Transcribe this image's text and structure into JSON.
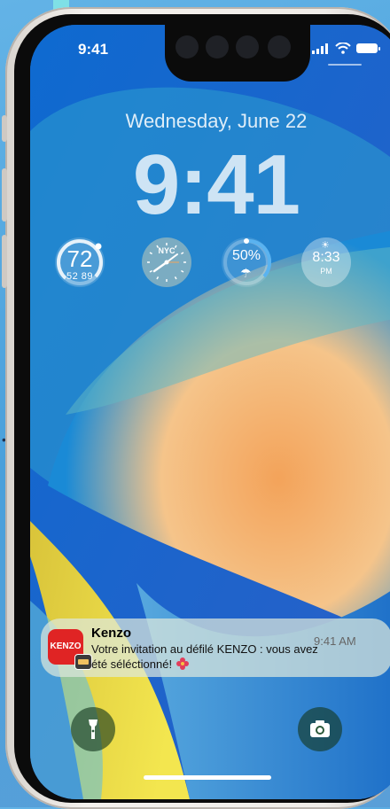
{
  "status_bar": {
    "time": "9:41"
  },
  "lock_screen": {
    "date": "Wednesday, June 22",
    "time": "9:41"
  },
  "widgets": {
    "temperature": {
      "value": "72",
      "range": "52 89"
    },
    "world_clock": {
      "city": "NYC"
    },
    "precipitation": {
      "value": "50%"
    },
    "sunset": {
      "time": "8:33",
      "period": "PM"
    }
  },
  "notification": {
    "app_icon_text": "KENZO",
    "title": "Kenzo",
    "time": "9:41 AM",
    "body": "Votre invitation au défilé KENZO : vous avez été séléctionné!"
  },
  "quick_actions": {
    "left_icon": "flashlight-icon",
    "right_icon": "camera-icon"
  },
  "colors": {
    "notification_app_accent": "#e02424",
    "wallpaper_orange": "#f3a35a",
    "wallpaper_yellow": "#e7d23a"
  }
}
